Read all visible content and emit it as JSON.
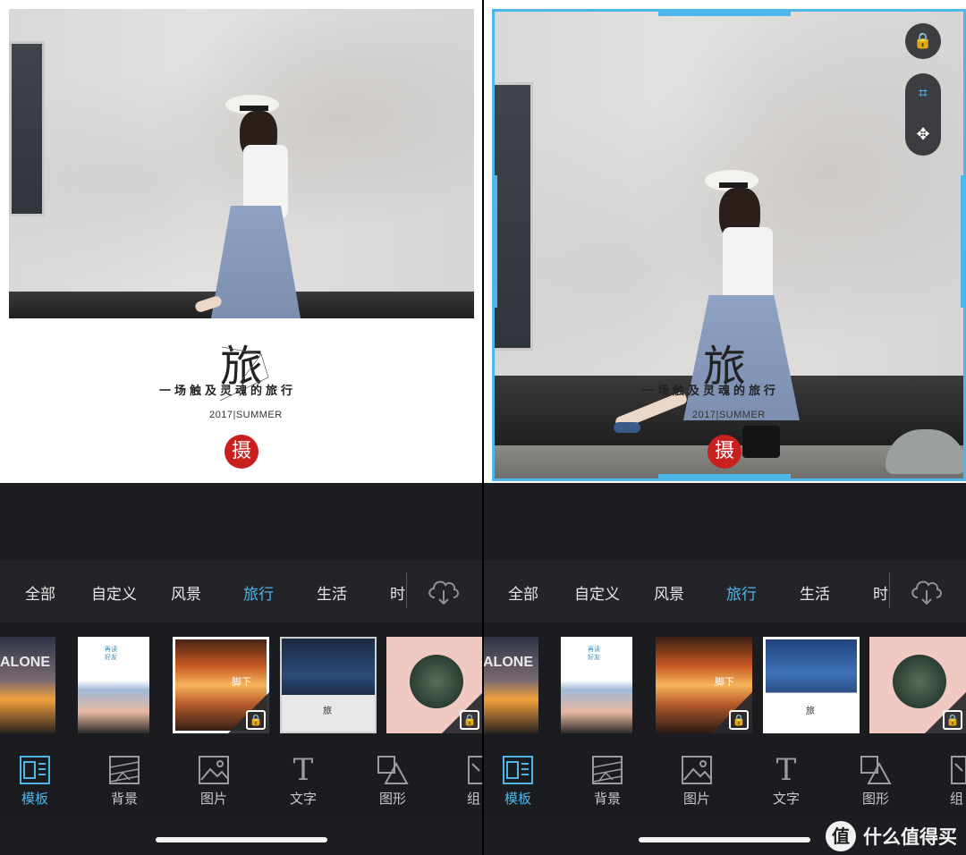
{
  "template_text": {
    "title": "旅",
    "subtitle": "一场触及灵魂的旅行",
    "year": "2017|SUMMER",
    "stamp": "摄"
  },
  "categories": [
    {
      "label": "全部",
      "active": false
    },
    {
      "label": "自定义",
      "active": false
    },
    {
      "label": "风景",
      "active": false
    },
    {
      "label": "旅行",
      "active": true
    },
    {
      "label": "生活",
      "active": false
    },
    {
      "label": "时",
      "active": false
    }
  ],
  "thumbnails": [
    {
      "name": "alone-sunset",
      "text": "ALONE",
      "locked": false
    },
    {
      "name": "beach-silhouette",
      "text": "再读好友",
      "locked": false
    },
    {
      "name": "desert-sunset",
      "text": "脚下",
      "locked": true
    },
    {
      "name": "sea-travel",
      "text": "旅",
      "locked": false
    },
    {
      "name": "pink-flowers",
      "text": "",
      "locked": true
    }
  ],
  "tools": [
    {
      "label": "模板",
      "icon": "template-icon",
      "active": true
    },
    {
      "label": "背景",
      "icon": "background-icon",
      "active": false
    },
    {
      "label": "图片",
      "icon": "image-icon",
      "active": false
    },
    {
      "label": "文字",
      "icon": "text-icon",
      "active": false
    },
    {
      "label": "图形",
      "icon": "shape-icon",
      "active": false
    },
    {
      "label": "组",
      "icon": "group-icon",
      "active": false
    }
  ],
  "text_tool_glyph": "T",
  "lock_glyph": "🔒",
  "crop_glyph": "⌗",
  "move_glyph": "✥",
  "watermark": {
    "icon_text": "值",
    "text": "什么值得买"
  },
  "colors": {
    "accent": "#4eb6e8",
    "stamp_red": "#c8201f",
    "dark_bg": "#1c1d21"
  }
}
